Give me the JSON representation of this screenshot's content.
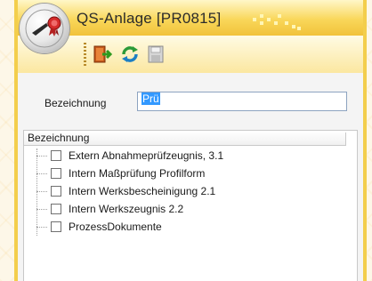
{
  "window": {
    "title": "QS-Anlage [PR0815]"
  },
  "toolbar": {
    "buttons": [
      {
        "name": "exit-icon"
      },
      {
        "name": "refresh-icon"
      },
      {
        "name": "save-icon"
      }
    ]
  },
  "form": {
    "bezeichnung_label": "Bezeichnung",
    "bezeichnung_value": "Prü"
  },
  "tree": {
    "header": "Bezeichnung",
    "items": [
      {
        "label": "Extern Abnahmeprüfzeugnis, 3.1",
        "checked": false
      },
      {
        "label": "Intern Maßprüfung Profilform",
        "checked": false
      },
      {
        "label": "Intern Werksbescheinigung 2.1",
        "checked": false
      },
      {
        "label": "Intern Werkszeugnis 2.2",
        "checked": false
      },
      {
        "label": "ProzessDokumente",
        "checked": false
      }
    ]
  },
  "colors": {
    "title_gradient_top": "#fff7c9",
    "title_gradient_bottom": "#f1c23a",
    "border_yellow": "#f3ce4c",
    "selection": "#3399ff"
  }
}
